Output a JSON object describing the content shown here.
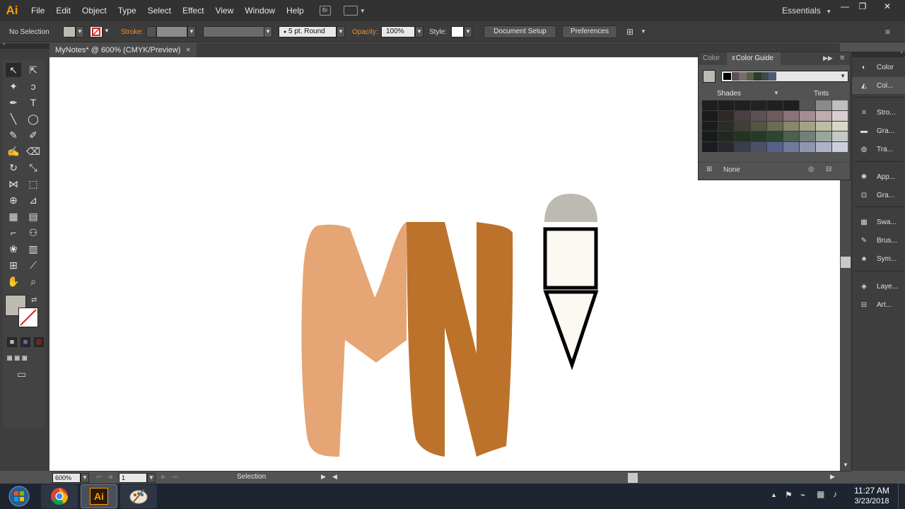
{
  "app": {
    "logo_text": "Ai"
  },
  "menubar": {
    "items": [
      "File",
      "Edit",
      "Object",
      "Type",
      "Select",
      "Effect",
      "View",
      "Window",
      "Help"
    ],
    "workspace": "Essentials",
    "workspace_arrow": "▾"
  },
  "window_controls": {
    "minimize": "—",
    "restore": "❐",
    "close": "✕"
  },
  "control_bar": {
    "selection": "No Selection",
    "stroke_label": "Stroke:",
    "brush": "5 pt. Round",
    "opacity_label": "Opacity:",
    "opacity_value": "100%",
    "style_label": "Style:",
    "document_setup": "Document Setup",
    "preferences": "Preferences"
  },
  "document_tab": {
    "title": "MyNotes* @ 600% (CMYK/Preview)",
    "close": "×"
  },
  "status_bar": {
    "zoom": "600%",
    "artboard": "1",
    "tool": "Selection"
  },
  "color_guide": {
    "tab_color": "Color",
    "tab_color_guide": "Color Guide",
    "shades": "Shades",
    "tints": "Tints",
    "harmony_none": "None",
    "harmony_colors": [
      "#000000",
      "#5d4f52",
      "#7a6b6e",
      "#5a5c4c",
      "#2c3c2c",
      "#3c4a4a",
      "#4f5a78"
    ],
    "swatches": [
      [
        "#1e1e1e",
        "#1e1e1e",
        "#202020",
        "#222222",
        "#202020",
        "#1e1e1e",
        "#555555",
        "#8a8a8a",
        "#bfbfbf"
      ],
      [
        "#1c1a1b",
        "#2e2829",
        "#4a3f42",
        "#5f5054",
        "#6e5b60",
        "#8a7478",
        "#a38e92",
        "#bfacaf",
        "#d8cfd1"
      ],
      [
        "#1c1c1a",
        "#2c2c26",
        "#3f4033",
        "#535541",
        "#6a6c53",
        "#86876c",
        "#a1a287",
        "#bcbea6",
        "#d7d8c8"
      ],
      [
        "#181c18",
        "#202820",
        "#233223",
        "#243a26",
        "#2c462f",
        "#4c604e",
        "#71817a",
        "#9aa69c",
        "#c2cac3"
      ],
      [
        "#1a1c20",
        "#27292f",
        "#3a3e4a",
        "#4a5066",
        "#59608a",
        "#707a9a",
        "#8f96b0",
        "#aeb3c8",
        "#cdd0dc"
      ]
    ]
  },
  "dock": {
    "items": [
      "Color",
      "Col...",
      "Stro...",
      "Gra...",
      "Tra...",
      "App...",
      "Gra...",
      "Swa...",
      "Brus...",
      "Sym...",
      "Laye...",
      "Art..."
    ]
  },
  "artwork": {
    "colors": {
      "m_fill": "#e5a574",
      "n_fill": "#bc722b",
      "cap_fill": "#bdbab2",
      "body_fill": "#fcf8f2",
      "stroke": "#000000"
    }
  },
  "taskbar": {
    "time": "11:27 AM",
    "date": "3/23/2018",
    "ai_label": "Ai"
  },
  "tool_colors": {
    "fill": "#bdbab2"
  }
}
